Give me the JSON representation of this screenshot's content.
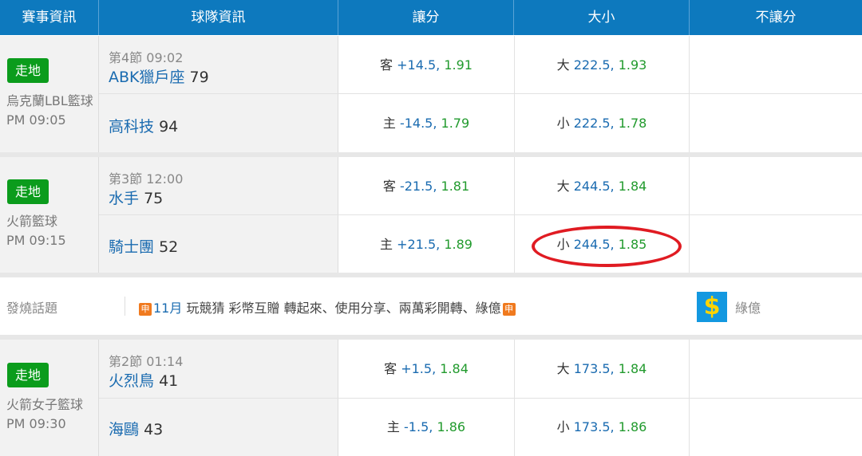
{
  "header": {
    "cols": [
      "賽事資訊",
      "球隊資訊",
      "讓分",
      "大小",
      "不讓分"
    ]
  },
  "games": [
    {
      "status": "走地",
      "league": "烏克蘭LBL籃球",
      "time": "PM 09:05",
      "period": "第4節 09:02",
      "away": {
        "name": "ABK獵戶座",
        "score": "79"
      },
      "home": {
        "name": "高科技",
        "score": "94"
      },
      "spread": [
        {
          "side": "客",
          "line": "+14.5,",
          "odds": "1.91"
        },
        {
          "side": "主",
          "line": "-14.5,",
          "odds": "1.79"
        }
      ],
      "total": [
        {
          "side": "大",
          "line": "222.5,",
          "odds": "1.93"
        },
        {
          "side": "小",
          "line": "222.5,",
          "odds": "1.78"
        }
      ]
    },
    {
      "status": "走地",
      "league": "火箭籃球",
      "time": "PM 09:15",
      "period": "第3節 12:00",
      "away": {
        "name": "水手",
        "score": "75"
      },
      "home": {
        "name": "騎士團",
        "score": "52"
      },
      "spread": [
        {
          "side": "客",
          "line": "-21.5,",
          "odds": "1.81"
        },
        {
          "side": "主",
          "line": "+21.5,",
          "odds": "1.89"
        }
      ],
      "total": [
        {
          "side": "大",
          "line": "244.5,",
          "odds": "1.84"
        },
        {
          "side": "小",
          "line": "244.5,",
          "odds": "1.85"
        }
      ]
    },
    {
      "status": "走地",
      "league": "火箭女子籃球",
      "time": "PM 09:30",
      "period": "第2節 01:14",
      "away": {
        "name": "火烈鳥",
        "score": "41"
      },
      "home": {
        "name": "海鷗",
        "score": "43"
      },
      "spread": [
        {
          "side": "客",
          "line": "+1.5,",
          "odds": "1.84"
        },
        {
          "side": "主",
          "line": "-1.5,",
          "odds": "1.86"
        }
      ],
      "total": [
        {
          "side": "大",
          "line": "173.5,",
          "odds": "1.84"
        },
        {
          "side": "小",
          "line": "173.5,",
          "odds": "1.86"
        }
      ]
    }
  ],
  "promo": {
    "label": "發燒話題",
    "tag": "申",
    "month": "11月",
    "text": " 玩競猜 彩幣互贈 轉起來、使用分享、兩萬彩開轉、綠億",
    "coin_symbol": "$",
    "coin_label": "綠億"
  },
  "colors": {
    "header_bg": "#0d79be",
    "live_badge": "#0b9c1c",
    "team_blue": "#1a6bb0",
    "odds_green": "#219a2d",
    "highlight_circle": "#e01b22"
  }
}
